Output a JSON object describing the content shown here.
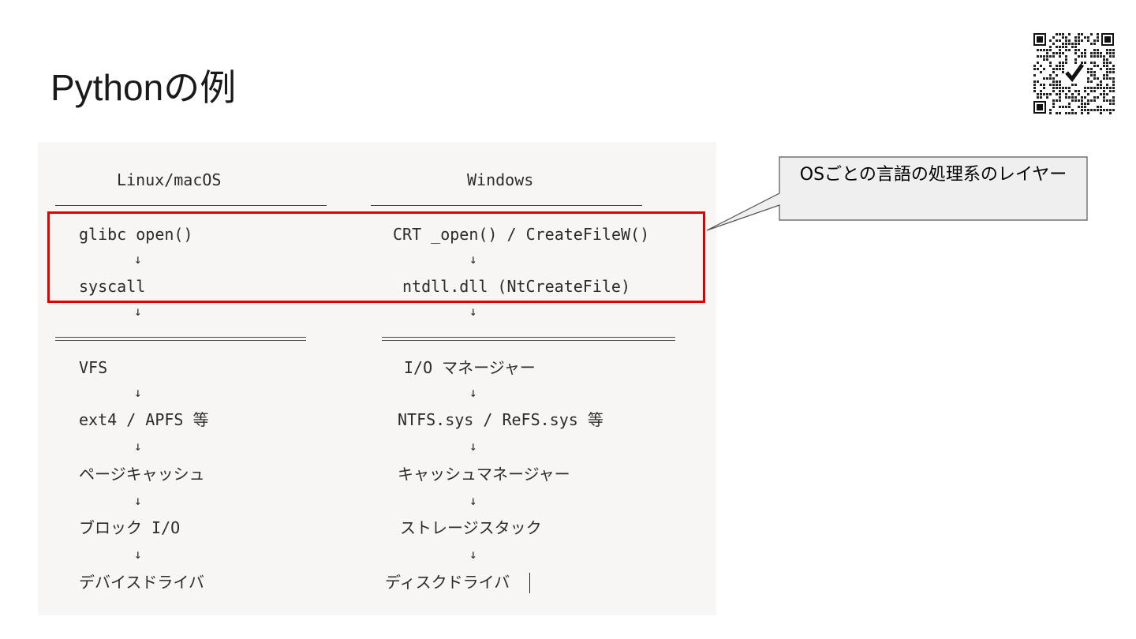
{
  "slide": {
    "title": "Pythonの例"
  },
  "callout": {
    "text": "OSごとの言語の処理系のレイヤー"
  },
  "diagram": {
    "arrow": "↓",
    "linux": {
      "header": "Linux/macOS",
      "runtime": [
        "glibc open()",
        "syscall"
      ],
      "kernel": [
        "VFS",
        "ext4 / APFS 等",
        "ページキャッシュ",
        "ブロック I/O",
        "デバイスドライバ"
      ]
    },
    "windows": {
      "header": "Windows",
      "runtime": [
        "CRT _open() / CreateFileW()",
        "ntdll.dll (NtCreateFile)"
      ],
      "kernel": [
        "I/O マネージャー",
        "NTFS.sys / ReFS.sys 等",
        "キャッシュマネージャー",
        "ストレージスタック",
        "ディスクドライバ"
      ]
    }
  },
  "colors": {
    "highlight": "#e00000",
    "panel_bg": "#f7f6f4",
    "callout_bg": "#efefef"
  }
}
